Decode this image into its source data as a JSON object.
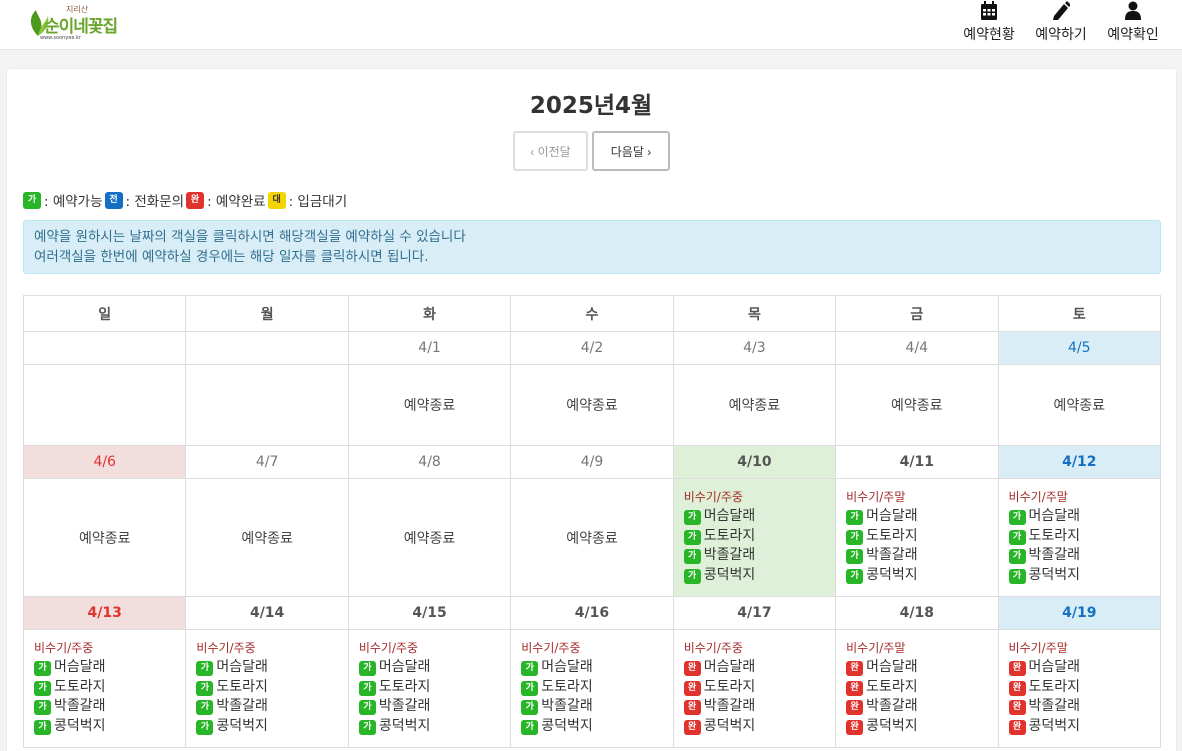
{
  "header": {
    "logo_text": "순이네꽃집",
    "logo_sub": "지리산",
    "logo_url": "www.soonyee.kr",
    "nav": [
      {
        "label": "예약현황",
        "icon": "calendar-icon"
      },
      {
        "label": "예약하기",
        "icon": "pencil-icon"
      },
      {
        "label": "예약확인",
        "icon": "user-icon"
      }
    ]
  },
  "page": {
    "title": "2025년4월",
    "prev_label": "‹  이전달",
    "next_label": "다음달  ›"
  },
  "legend": [
    {
      "badge": "가",
      "text": ": 예약가능"
    },
    {
      "badge": "전",
      "text": ": 전화문의"
    },
    {
      "badge": "완",
      "text": ": 예약완료"
    },
    {
      "badge": "대",
      "text": ": 입금대기"
    }
  ],
  "notice": {
    "line1": "예약을 원하시는 날짜의 객실을 클릭하시면 해당객실을 예약하실 수 있습니다",
    "line2": "여러객실을 한번에 예약하실 경우에는 해당 일자를 클릭하시면 됩니다."
  },
  "calendar": {
    "weekdays": [
      "일",
      "월",
      "화",
      "수",
      "목",
      "금",
      "토"
    ],
    "closed_label": "예약종료",
    "rooms": [
      "머슴달래",
      "도토라지",
      "박졸갈래",
      "콩덕벅지"
    ],
    "badge_available": "가",
    "badge_done": "완",
    "weeks": [
      [
        {
          "date": "",
          "status": "empty"
        },
        {
          "date": "",
          "status": "empty"
        },
        {
          "date": "4/1",
          "status": "closed"
        },
        {
          "date": "4/2",
          "status": "closed"
        },
        {
          "date": "4/3",
          "status": "closed"
        },
        {
          "date": "4/4",
          "status": "closed"
        },
        {
          "date": "4/5",
          "status": "closed"
        }
      ],
      [
        {
          "date": "4/6",
          "status": "closed"
        },
        {
          "date": "4/7",
          "status": "closed"
        },
        {
          "date": "4/8",
          "status": "closed"
        },
        {
          "date": "4/9",
          "status": "closed"
        },
        {
          "date": "4/10",
          "status": "open",
          "season": "비수기/주중",
          "rooms": [
            "가",
            "가",
            "가",
            "가"
          ]
        },
        {
          "date": "4/11",
          "status": "open",
          "season": "비수기/주말",
          "rooms": [
            "가",
            "가",
            "가",
            "가"
          ]
        },
        {
          "date": "4/12",
          "status": "open",
          "season": "비수기/주말",
          "rooms": [
            "가",
            "가",
            "가",
            "가"
          ]
        }
      ],
      [
        {
          "date": "4/13",
          "status": "open",
          "season": "비수기/주중",
          "rooms": [
            "가",
            "가",
            "가",
            "가"
          ]
        },
        {
          "date": "4/14",
          "status": "open",
          "season": "비수기/주중",
          "rooms": [
            "가",
            "가",
            "가",
            "가"
          ]
        },
        {
          "date": "4/15",
          "status": "open",
          "season": "비수기/주중",
          "rooms": [
            "가",
            "가",
            "가",
            "가"
          ]
        },
        {
          "date": "4/16",
          "status": "open",
          "season": "비수기/주중",
          "rooms": [
            "가",
            "가",
            "가",
            "가"
          ]
        },
        {
          "date": "4/17",
          "status": "open",
          "season": "비수기/주중",
          "rooms": [
            "완",
            "완",
            "완",
            "완"
          ]
        },
        {
          "date": "4/18",
          "status": "open",
          "season": "비수기/주말",
          "rooms": [
            "완",
            "완",
            "완",
            "완"
          ]
        },
        {
          "date": "4/19",
          "status": "open",
          "season": "비수기/주말",
          "rooms": [
            "완",
            "완",
            "완",
            "완"
          ]
        }
      ]
    ]
  },
  "colors": {
    "available": "#28b628",
    "phone": "#1570c4",
    "done": "#e0332e",
    "waiting": "#f2d400",
    "today": "#dff0d8"
  }
}
